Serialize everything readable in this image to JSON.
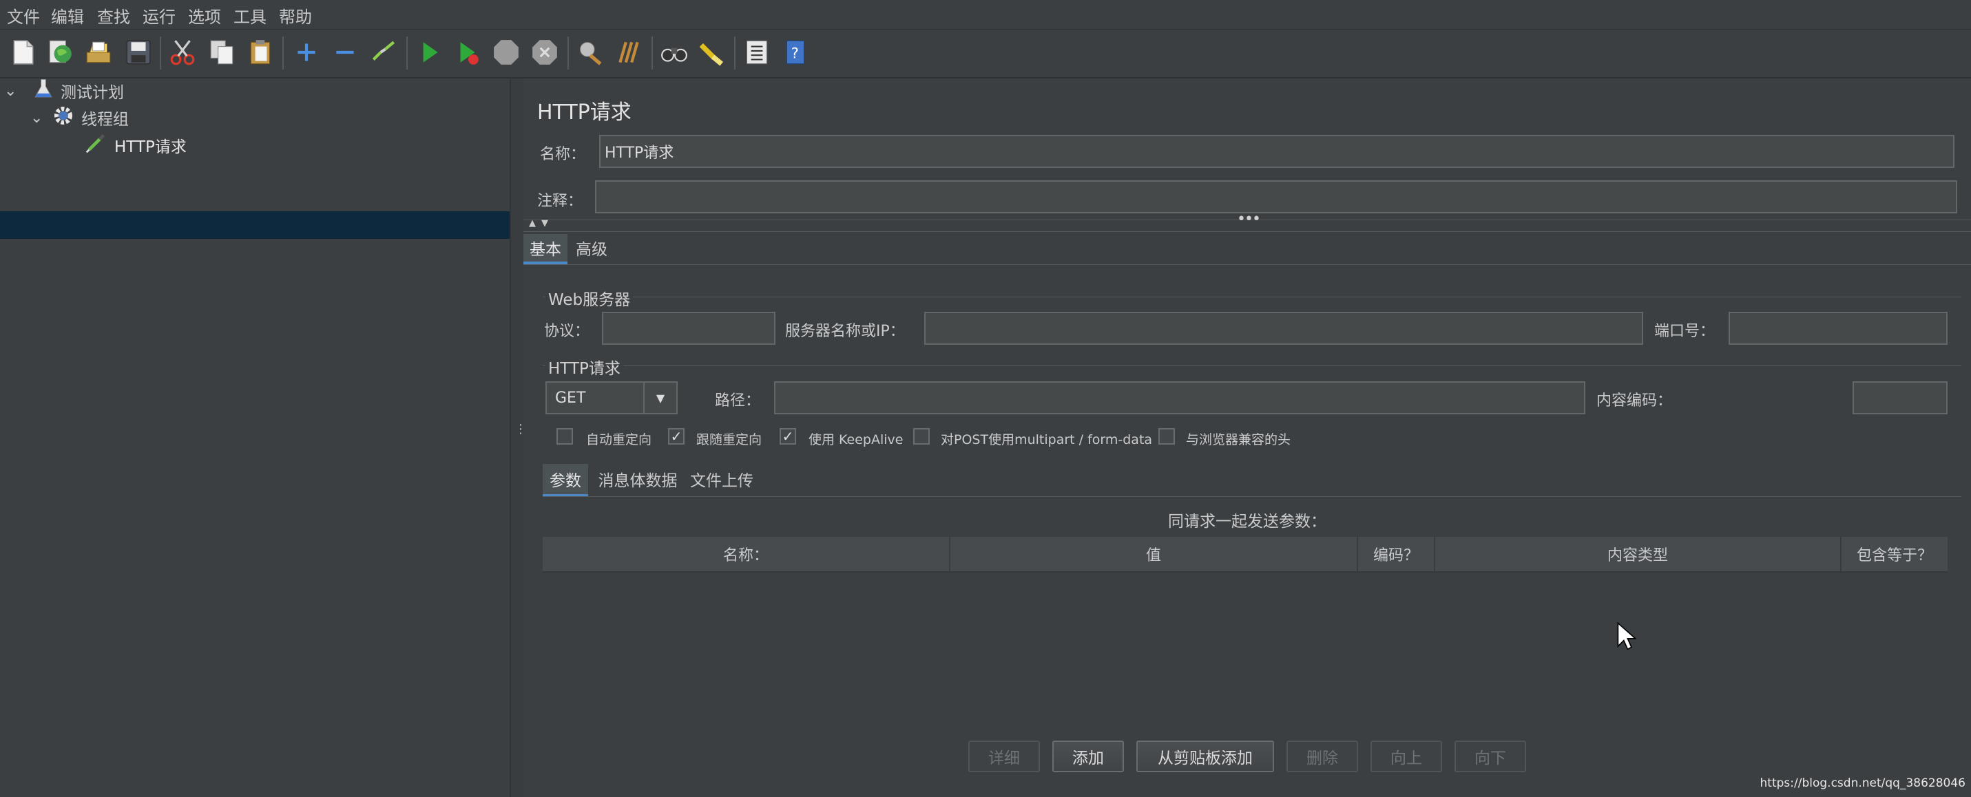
{
  "menu": [
    "文件",
    "编辑",
    "查找",
    "运行",
    "选项",
    "工具",
    "帮助"
  ],
  "toolbar": {
    "icons": [
      "new-icon",
      "templates-icon",
      "open-icon",
      "save-icon",
      "cut-icon",
      "copy-icon",
      "paste-icon",
      "expand-icon",
      "collapse-icon",
      "toggle-icon",
      "start-icon",
      "start-no-pauses-icon",
      "stop-icon",
      "shutdown-icon",
      "clear-icon",
      "clear-all-icon",
      "search-icon",
      "reset-search-icon",
      "function-helper-icon",
      "help-icon"
    ]
  },
  "tree": {
    "test_plan": "测试计划",
    "thread_group": "线程组",
    "http_request": "HTTP请求"
  },
  "panel": {
    "title": "HTTP请求",
    "name_label": "名称：",
    "name_value": "HTTP请求",
    "comment_label": "注释：",
    "comment_value": ""
  },
  "tabs": {
    "basic": "基本",
    "advanced": "高级"
  },
  "web_server": {
    "section": "Web服务器",
    "protocol_label": "协议：",
    "protocol_value": "",
    "server_label": "服务器名称或IP：",
    "server_value": "",
    "port_label": "端口号：",
    "port_value": ""
  },
  "http_request": {
    "section": "HTTP请求",
    "method": "GET",
    "path_label": "路径：",
    "path_value": "",
    "encoding_label": "内容编码：",
    "encoding_value": ""
  },
  "options": [
    {
      "label": "自动重定向",
      "checked": false
    },
    {
      "label": "跟随重定向",
      "checked": true
    },
    {
      "label": "使用 KeepAlive",
      "checked": true
    },
    {
      "label": "对POST使用multipart / form-data",
      "checked": false
    },
    {
      "label": "与浏览器兼容的头",
      "checked": false
    }
  ],
  "subtabs": {
    "params": "参数",
    "body": "消息体数据",
    "files": "文件上传"
  },
  "params_table": {
    "caption": "同请求一起发送参数：",
    "headers": [
      "名称：",
      "值",
      "编码？",
      "内容类型",
      "包含等于？"
    ]
  },
  "buttons": {
    "detail": "详细",
    "add": "添加",
    "add_clipboard": "从剪贴板添加",
    "delete": "删除",
    "up": "向上",
    "down": "向下"
  },
  "watermark": "https://blog.csdn.net/qq_38628046",
  "colors": {
    "background": "#3c3f41",
    "selection": "#0d293e",
    "accent": "#4a88c7"
  }
}
